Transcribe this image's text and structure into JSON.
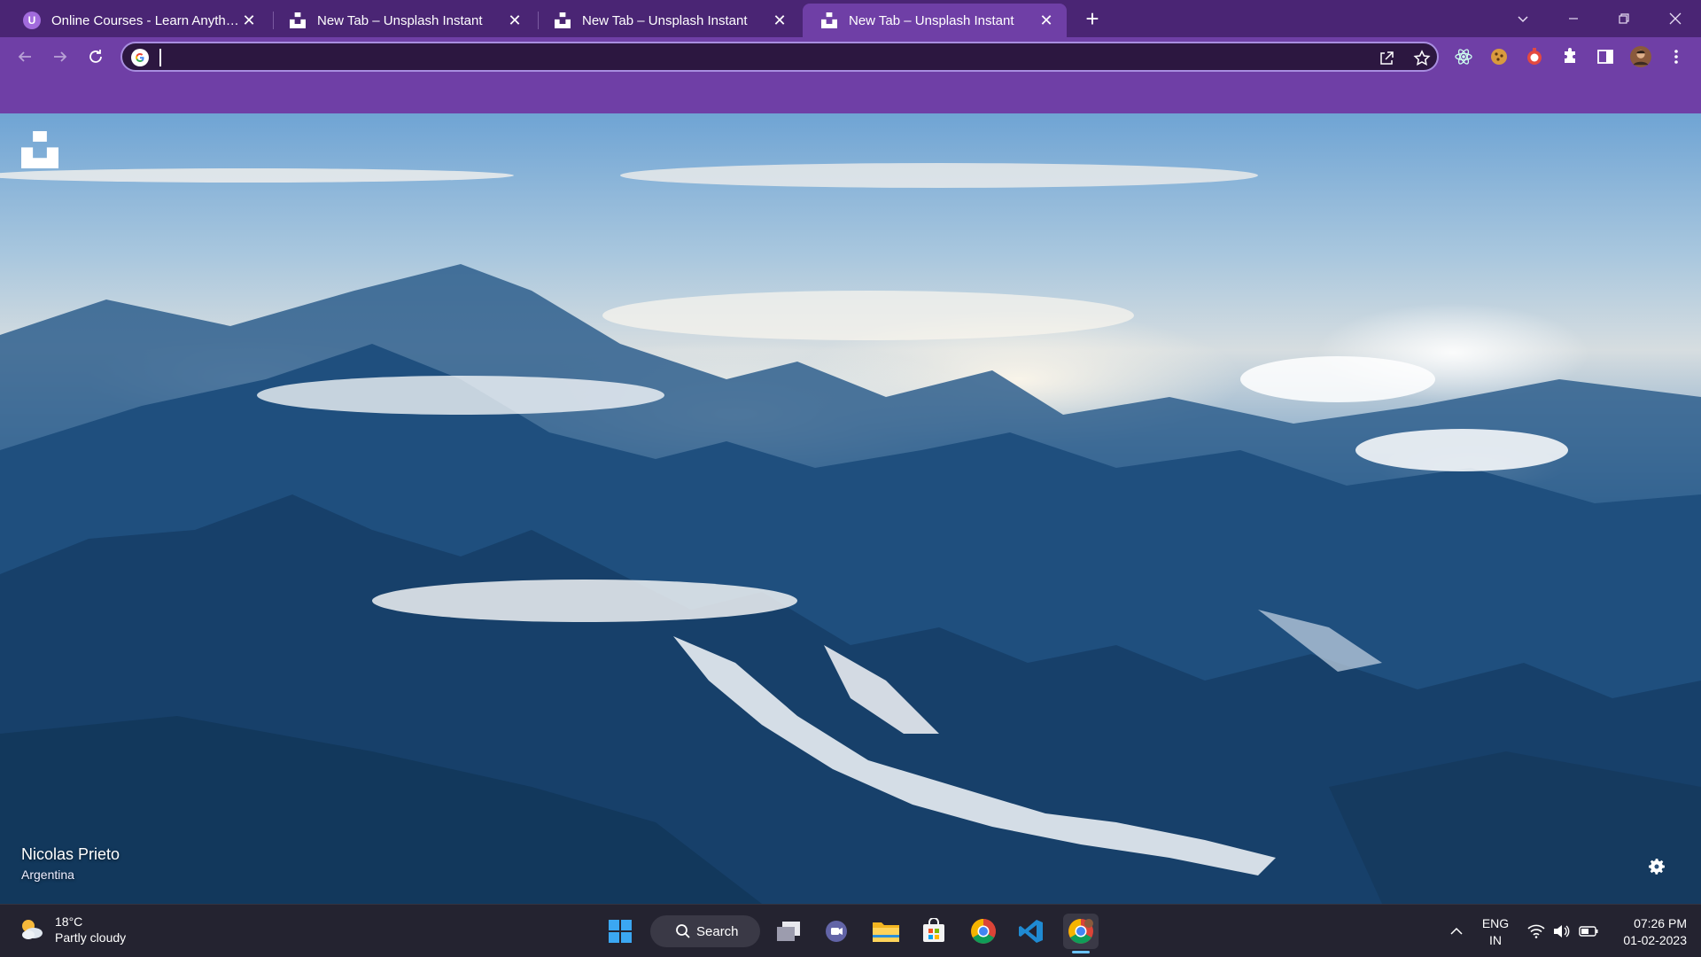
{
  "browser": {
    "tabs": [
      {
        "title": "Online Courses - Learn Anything,",
        "favicon": "udemy-icon",
        "active": false
      },
      {
        "title": "New Tab – Unsplash Instant",
        "favicon": "unsplash-icon",
        "active": false
      },
      {
        "title": "New Tab – Unsplash Instant",
        "favicon": "unsplash-icon",
        "active": false
      },
      {
        "title": "New Tab – Unsplash Instant",
        "favicon": "unsplash-icon",
        "active": true
      }
    ],
    "favicon_letter": "U",
    "new_tab_label": "+",
    "close_label": "✕",
    "address_bar": {
      "value": "",
      "placeholder": ""
    }
  },
  "page": {
    "photographer": "Nicolas Prieto",
    "location": "Argentina"
  },
  "taskbar": {
    "weather_temp": "18°C",
    "weather_desc": "Partly cloudy",
    "search_label": "Search",
    "language_line1": "ENG",
    "language_line2": "IN",
    "time": "07:26 PM",
    "date": "01-02-2023"
  },
  "colors": {
    "tabstrip": "#4a2574",
    "toolbar": "#6f3fa6",
    "taskbar": "#242330"
  }
}
